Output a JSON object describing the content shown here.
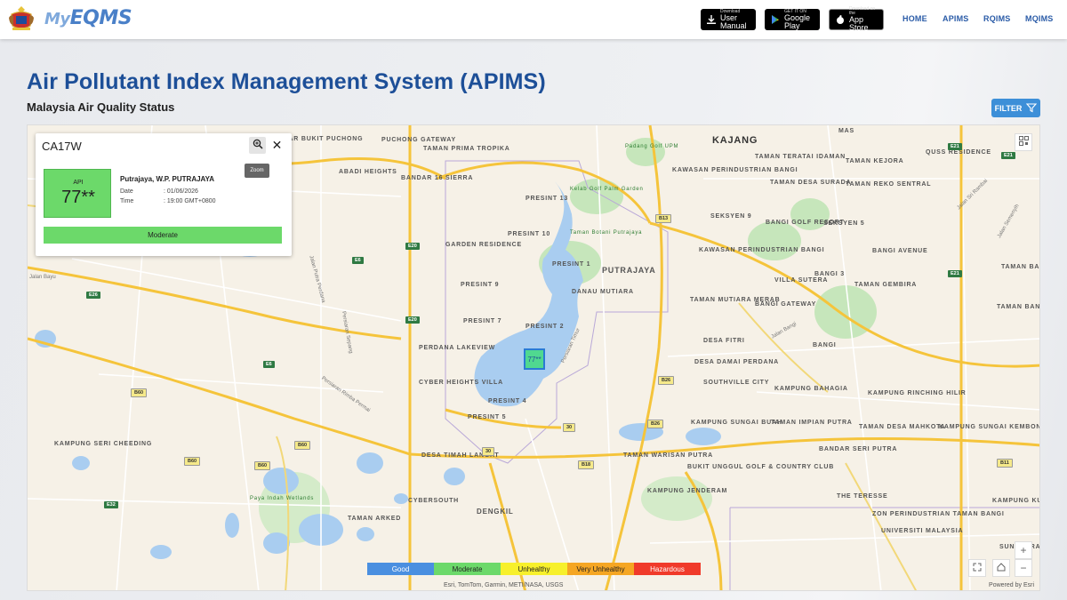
{
  "header": {
    "logo_text": "EQMS",
    "logo_prefix": "My",
    "buttons": [
      {
        "small": "Download",
        "big": "User Manual",
        "icon": "download-icon"
      },
      {
        "small": "GET IT ON",
        "big": "Google Play",
        "icon": "google-play-icon"
      },
      {
        "small": "Download on the",
        "big": "App Store",
        "icon": "apple-icon"
      }
    ],
    "nav": [
      "HOME",
      "APIMS",
      "RQIMS",
      "MQIMS"
    ]
  },
  "page": {
    "title": "Air Pollutant Index Management System (APIMS)",
    "subtitle": "Malaysia Air Quality Status",
    "filter_label": "FILTER"
  },
  "popup": {
    "station_id": "CA17W",
    "zoom_tooltip": "Zoom",
    "api_label": "API",
    "api_value": "77**",
    "location": "Putrajaya, W.P. PUTRAJAYA",
    "date_label": "Date",
    "date_value": ": 01/06/2026",
    "time_label": "Time",
    "time_value": ": 19:00 GMT+0800",
    "status": "Moderate",
    "status_color": "#6cd96a"
  },
  "map": {
    "marker_value": "77**",
    "attribution": "Esri, TomTom, Garmin, METI/NASA, USGS",
    "powered_by": "Powered by Esri",
    "labels": [
      "BANDAR BUKIT PUCHONG",
      "PUCHONG GATEWAY",
      "TAMAN PRIMA TROPIKA",
      "KAJANG",
      "MAS",
      "ABADI HEIGHTS",
      "BANDAR 16 SIERRA",
      "PRESINT 13",
      "TAMAN TERATAI IDAMAN",
      "TAMAN KEJORA",
      "QUSS RESIDENCE",
      "KAWASAN PERINDUSTRIAN BANGI",
      "TAMAN DESA SURADA",
      "TAMAN REKO SENTRAL",
      "GARDEN RESIDENCE",
      "PRESINT 10",
      "SEKSYEN 9",
      "BANGI GOLF RESORT",
      "SEKSYEN 5",
      "PRESINT 1",
      "PUTRAJAYA",
      "KAWASAN PERINDUSTRIAN BANGI",
      "BANGI AVENUE",
      "TAMAN BANGI PERDANA",
      "BANGI 3",
      "PRESINT 9",
      "DANAU MUTIARA",
      "TAMAN GEMBIRA",
      "VILLA SUTERA",
      "PRESINT 7",
      "PRESINT 2",
      "TAMAN MUTIARA MERAB",
      "BANGI GATEWAY",
      "TAMAN BANGI SOUS",
      "PERDANA LAKEVIEW",
      "DESA FITRI",
      "BANGI",
      "DESA DAMAI PERDANA",
      "CYBER HEIGHTS VILLA",
      "PRESINT 4",
      "SOUTHVILLE CITY",
      "KAMPUNG BAHAGIA",
      "KAMPUNG RINCHING HILIR",
      "PRESINT 5",
      "TAMAN IMPIAN PUTRA",
      "KAMPUNG SUNGAI BUAH",
      "TAMAN DESA MAHKOTA",
      "KAMPUNG SUNGAI KEMBONG",
      "KAMPUNG SERI CHEEDING",
      "DESA TIMAH LANGAT",
      "TAMAN WARISAN PUTRA",
      "BANDAR SERI PUTRA",
      "BUKIT UNGGUL GOLF & COUNTRY CLUB",
      "KAMPUNG JENDERAM",
      "THE TERESSE",
      "CYBERSOUTH",
      "TAMAN ARKED",
      "DENGKIL",
      "ZON PERINDUSTRIAN TAMAN BANGI",
      "KAMPUNG KUALA PAJAM",
      "UNIVERSITI MALAYSIA",
      "SUNGAI RAMAL",
      "Paya Indah Wetlands",
      "Padang Golf UPM",
      "Kelab Golf Palm Garden",
      "Taman Botani Putrajaya"
    ],
    "roads": [
      "E26",
      "E6",
      "E20",
      "E21",
      "E32",
      "B60",
      "B13",
      "B26",
      "B18",
      "B11",
      "30",
      "Jalan Putra Perdana",
      "Persiaran Sepang",
      "Persiaran Rimba Permai",
      "Persiaran Timur",
      "Jalan Bangi",
      "Jalan Semenyih",
      "Jalan Sri Rambai",
      "Jalan Bayu"
    ]
  },
  "legend": [
    {
      "label": "Good",
      "color": "#4a8fe0"
    },
    {
      "label": "Moderate",
      "color": "#6cd96a"
    },
    {
      "label": "Unhealthy",
      "color": "#f7f02b"
    },
    {
      "label": "Very Unhealthy",
      "color": "#f5a623"
    },
    {
      "label": "Hazardous",
      "color": "#f03a2a"
    }
  ],
  "colors": {
    "brand_blue": "#1d4f98",
    "nav_blue": "#2a5ba7",
    "filter_blue": "#3d8fd8",
    "water": "#a9cdf0",
    "park": "#bfe3b5",
    "road_major": "#f5c43b"
  }
}
